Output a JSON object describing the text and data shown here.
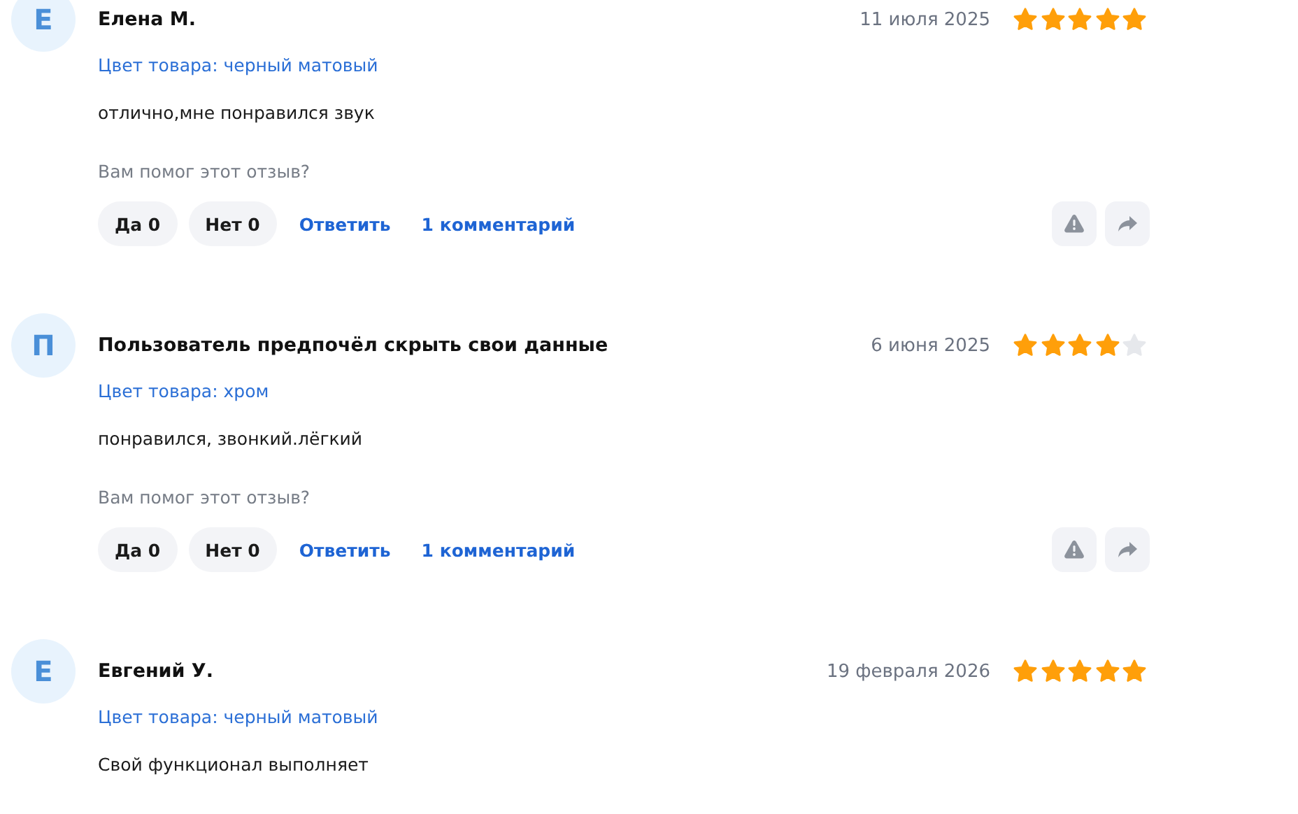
{
  "reviews": [
    {
      "avatar": "Е",
      "author": "Елена М.",
      "date": "11 июля 2025",
      "stars": 5,
      "color_label": "Цвет товара: черный матовый",
      "text": "отлично,мне понравился звук",
      "helpful_question": "Вам помог этот отзыв?",
      "yes": "Да 0",
      "no": "Нет 0",
      "reply": "Ответить",
      "comments": "1 комментарий"
    },
    {
      "avatar": "П",
      "author": "Пользователь предпочёл скрыть свои данные",
      "date": "6 июня 2025",
      "stars": 4,
      "color_label": "Цвет товара: хром",
      "text": "понравился, звонкий.лёгкий",
      "helpful_question": "Вам помог этот отзыв?",
      "yes": "Да 0",
      "no": "Нет 0",
      "reply": "Ответить",
      "comments": "1 комментарий"
    },
    {
      "avatar": "Е",
      "author": "Евгений У.",
      "date": "19 февраля 2026",
      "stars": 5,
      "color_label": "Цвет товара: черный матовый",
      "text": "Свой функционал выполняет"
    }
  ]
}
